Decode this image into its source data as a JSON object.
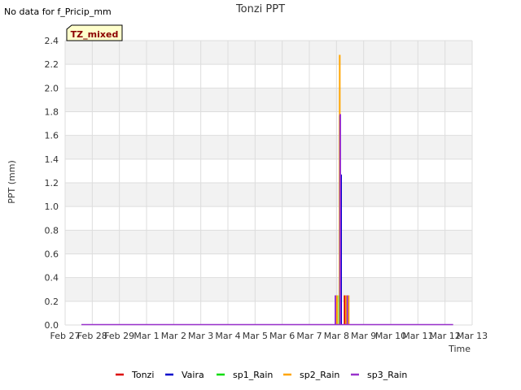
{
  "header": {
    "no_data_note": "No data for f_Pricip_mm"
  },
  "badge": {
    "label": "TZ_mixed"
  },
  "chart_data": {
    "type": "bar",
    "title": "Tonzi PPT",
    "xlabel": "Time",
    "ylabel": "PPT (mm)",
    "ylim": [
      0,
      2.4
    ],
    "yticks": [
      "0.0",
      "0.2",
      "0.4",
      "0.6",
      "0.8",
      "1.0",
      "1.2",
      "1.4",
      "1.6",
      "1.8",
      "2.0",
      "2.2",
      "2.4"
    ],
    "xlim_days": [
      0,
      15
    ],
    "xticks": [
      "Feb 27",
      "Feb 28",
      "Feb 29",
      "Mar 1",
      "Mar 2",
      "Mar 3",
      "Mar 4",
      "Mar 5",
      "Mar 6",
      "Mar 7",
      "Mar 8",
      "Mar 9",
      "Mar 10",
      "Mar 11",
      "Mar 12",
      "Mar 13"
    ],
    "baseline_range_days": [
      0.6,
      14.3
    ],
    "grid": true,
    "legend_position": "bottom",
    "series": [
      {
        "name": "Tonzi",
        "color": "#dd0000",
        "points": [
          [
            10.15,
            0.25
          ],
          [
            10.3,
            0.25
          ],
          [
            10.42,
            0.25
          ]
        ]
      },
      {
        "name": "Vaira",
        "color": "#0000cc",
        "points": [
          [
            9.98,
            0.25
          ],
          [
            10.12,
            1.77
          ],
          [
            10.17,
            1.27
          ]
        ]
      },
      {
        "name": "sp1_Rain",
        "color": "#00dd00",
        "points": [
          [
            10.0,
            0.25
          ],
          [
            10.1,
            0.25
          ]
        ]
      },
      {
        "name": "sp2_Rain",
        "color": "#ffa500",
        "points": [
          [
            10.02,
            0.25
          ],
          [
            10.12,
            2.28
          ],
          [
            10.35,
            0.25
          ],
          [
            10.45,
            0.25
          ]
        ]
      },
      {
        "name": "sp3_Rain",
        "color": "#9932cc",
        "points": [
          [
            9.96,
            0.25
          ],
          [
            10.14,
            1.78
          ],
          [
            10.4,
            0.25
          ]
        ]
      }
    ]
  }
}
